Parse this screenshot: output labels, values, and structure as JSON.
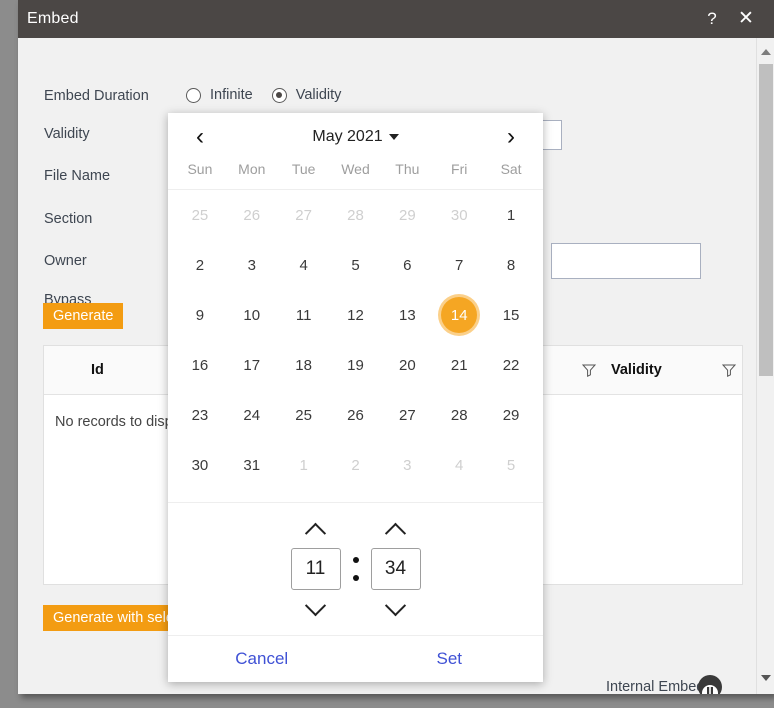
{
  "window": {
    "title": "Embed",
    "help_label": "?",
    "close_label": "✕"
  },
  "form": {
    "labels": {
      "embed_duration": "Embed Duration",
      "validity": "Validity",
      "file_name": "File Name",
      "section": "Section",
      "owner": "Owner",
      "bypass": "Bypass"
    },
    "duration_options": [
      {
        "label": "Infinite",
        "checked": false
      },
      {
        "label": "Validity",
        "checked": true
      }
    ],
    "validity_input": {
      "value": "",
      "placeholder": ""
    },
    "generate_label": "Generate",
    "generate_with_selection_label": "Generate with selecti"
  },
  "grid": {
    "columns": [
      {
        "label": "Id"
      },
      {
        "label": "Validity"
      }
    ],
    "empty_text": "No records to displa",
    "filter_icon": "funnel-icon"
  },
  "footer": {
    "internal_embed_label": "Internal Embed",
    "badge_icon": "embed-badge-icon"
  },
  "scrollbar": {
    "up_icon": "triangle-up-icon",
    "down_icon": "triangle-down-icon"
  },
  "datepicker": {
    "prev_label": "‹",
    "next_label": "›",
    "month_title": "May 2021",
    "weekdays": [
      "Sun",
      "Mon",
      "Tue",
      "Wed",
      "Thu",
      "Fri",
      "Sat"
    ],
    "days": [
      {
        "n": "25",
        "muted": true
      },
      {
        "n": "26",
        "muted": true
      },
      {
        "n": "27",
        "muted": true
      },
      {
        "n": "28",
        "muted": true
      },
      {
        "n": "29",
        "muted": true
      },
      {
        "n": "30",
        "muted": true
      },
      {
        "n": "1",
        "muted": false
      },
      {
        "n": "2",
        "muted": false
      },
      {
        "n": "3",
        "muted": false
      },
      {
        "n": "4",
        "muted": false
      },
      {
        "n": "5",
        "muted": false
      },
      {
        "n": "6",
        "muted": false
      },
      {
        "n": "7",
        "muted": false
      },
      {
        "n": "8",
        "muted": false
      },
      {
        "n": "9",
        "muted": false
      },
      {
        "n": "10",
        "muted": false
      },
      {
        "n": "11",
        "muted": false
      },
      {
        "n": "12",
        "muted": false
      },
      {
        "n": "13",
        "muted": false
      },
      {
        "n": "14",
        "muted": false,
        "selected": true
      },
      {
        "n": "15",
        "muted": false
      },
      {
        "n": "16",
        "muted": false
      },
      {
        "n": "17",
        "muted": false
      },
      {
        "n": "18",
        "muted": false
      },
      {
        "n": "19",
        "muted": false
      },
      {
        "n": "20",
        "muted": false
      },
      {
        "n": "21",
        "muted": false
      },
      {
        "n": "22",
        "muted": false
      },
      {
        "n": "23",
        "muted": false
      },
      {
        "n": "24",
        "muted": false
      },
      {
        "n": "25",
        "muted": false
      },
      {
        "n": "26",
        "muted": false
      },
      {
        "n": "27",
        "muted": false
      },
      {
        "n": "28",
        "muted": false
      },
      {
        "n": "29",
        "muted": false
      },
      {
        "n": "30",
        "muted": false
      },
      {
        "n": "31",
        "muted": false
      },
      {
        "n": "1",
        "muted": true
      },
      {
        "n": "2",
        "muted": true
      },
      {
        "n": "3",
        "muted": true
      },
      {
        "n": "4",
        "muted": true
      },
      {
        "n": "5",
        "muted": true
      }
    ],
    "selected_day": "14",
    "time": {
      "hour": "11",
      "minute": "34",
      "separator": ":"
    },
    "cancel_label": "Cancel",
    "set_label": "Set"
  },
  "colors": {
    "accent_orange": "#f39c12",
    "selected_day_orange": "#f5a623",
    "selected_ring": "#fbd08a",
    "titlebar": "#4b4745",
    "link_blue": "#3f51d5",
    "dialog_bg": "#f1f1f1"
  }
}
